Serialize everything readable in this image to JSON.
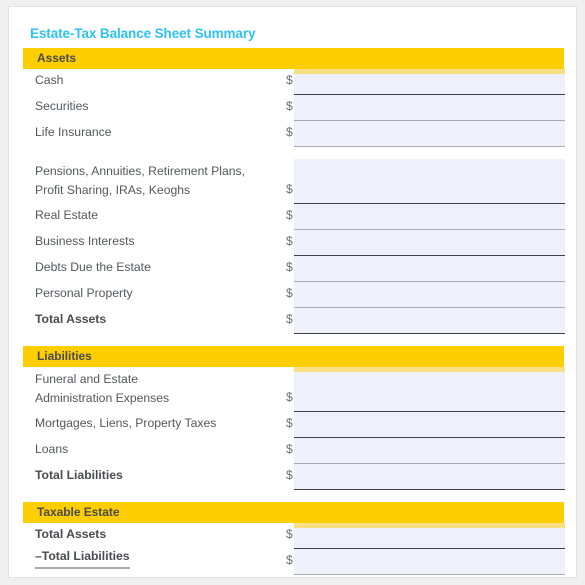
{
  "document": {
    "title": "Estate-Tax Balance Sheet Summary",
    "currency_symbol": "$"
  },
  "colors": {
    "title_accent": "#2cc3f1",
    "section_bar": "#ffce00",
    "field_fill": "#eef0fa",
    "rule_dark": "#3f4047",
    "rule_light": "#aaabb2",
    "label_text": "#55565f",
    "page_background": "#f0f0f0"
  },
  "sections": [
    {
      "heading": "Assets",
      "rows": [
        {
          "label": "Cash"
        },
        {
          "label": "Securities"
        },
        {
          "label": "Life Insurance"
        },
        {
          "label_line1": "Pensions, Annuities, Retirement Plans,",
          "label_line2": "Profit Sharing, IRAs, Keoghs"
        },
        {
          "label": "Real Estate"
        },
        {
          "label": "Business Interests"
        },
        {
          "label": "Debts Due the Estate"
        },
        {
          "label": "Personal Property"
        },
        {
          "label": "Total Assets"
        }
      ]
    },
    {
      "heading": "Liabilities",
      "rows": [
        {
          "label_line1": "Funeral and Estate",
          "label_line2": "Administration Expenses"
        },
        {
          "label": "Mortgages, Liens, Property Taxes"
        },
        {
          "label": "Loans"
        },
        {
          "label": "Total Liabilities"
        }
      ]
    },
    {
      "heading": "Taxable Estate",
      "rows": [
        {
          "label": "Total Assets"
        },
        {
          "label": "–Total Liabilities"
        }
      ]
    }
  ]
}
